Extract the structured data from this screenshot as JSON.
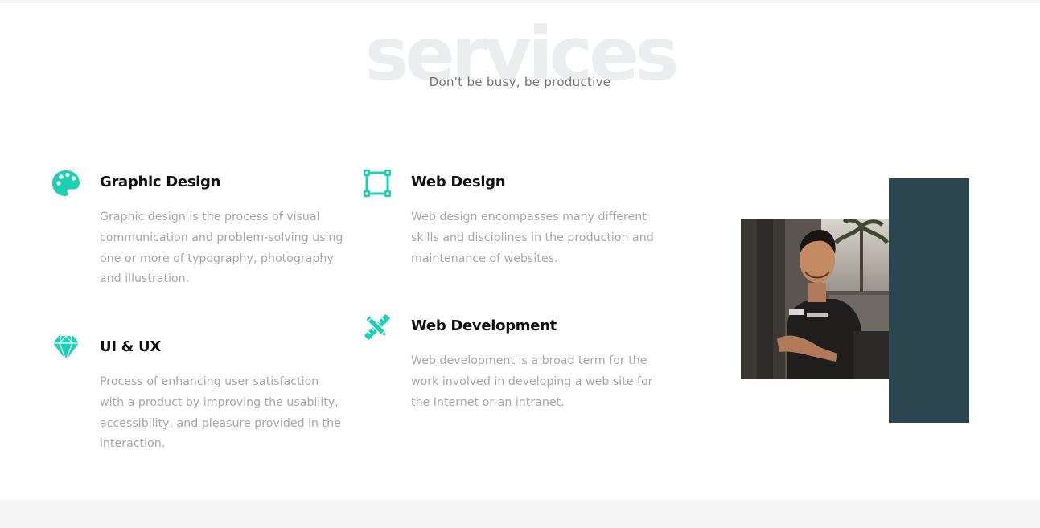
{
  "section": {
    "background_word": "services",
    "subtitle": "Don't be busy, be productive"
  },
  "services": [
    {
      "icon": "palette-icon",
      "title": "Graphic Design",
      "description": "Graphic design is the process of visual communication and problem-solving using one or more of typography, photography and illustration."
    },
    {
      "icon": "vector-square-icon",
      "title": "Web Design",
      "description": "Web design encompasses many different skills and disciplines in the production and maintenance of websites."
    },
    {
      "icon": "gem-icon",
      "title": "UI & UX",
      "description": "Process of enhancing user satisfaction with a product by improving the usability, accessibility, and pleasure provided in the interaction."
    },
    {
      "icon": "pencil-ruler-icon",
      "title": "Web Development",
      "description": "Web development is a broad term for the work involved in developing a web site for the Internet or an intranet."
    }
  ],
  "colors": {
    "accent": "#1dcfb3",
    "heading": "#111111",
    "body_text": "#a6a6a6",
    "photo_accent_block": "#2c4650",
    "background_word": "#ebedef"
  }
}
